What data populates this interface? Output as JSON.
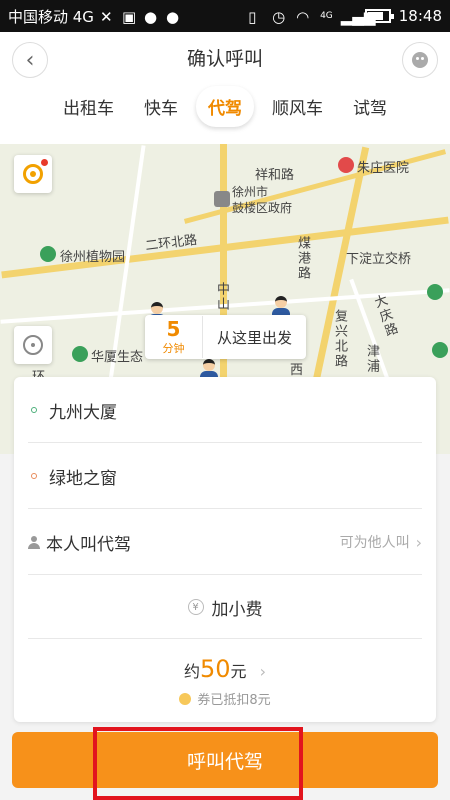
{
  "status_bar": {
    "carrier": "中国移动 4G",
    "network": "4G",
    "time": "18:48"
  },
  "header": {
    "title": "确认呼叫",
    "tabs": [
      {
        "label": "出租车",
        "active": false
      },
      {
        "label": "快车",
        "active": false
      },
      {
        "label": "代驾",
        "active": true
      },
      {
        "label": "顺风车",
        "active": false
      },
      {
        "label": "试驾",
        "active": false
      }
    ]
  },
  "map": {
    "labels": {
      "road_xianghe": "祥和路",
      "hospital": "朱庄医院",
      "gov": "徐州市\n鼓楼区政府",
      "botanical": "徐州植物园",
      "ring_road": "二环北路",
      "meigang": "煤港路",
      "xiadian": "下淀立交桥",
      "zhongshan": "中山",
      "daqing": "大庆路",
      "fuxing": "复兴北路",
      "jinpu": "津浦",
      "huaxia": "华厦生态",
      "xi": "西",
      "wu": "环"
    },
    "eta": {
      "minutes": "5",
      "unit": "分钟",
      "text": "从这里出发"
    }
  },
  "form": {
    "start": "九州大厦",
    "destination": "绿地之窗",
    "caller": "本人叫代驾",
    "for_others": "可为他人叫",
    "tip_label": "加小费",
    "price_prefix": "约",
    "price_value": "50",
    "price_unit": "元",
    "coupon_text": "券已抵扣8元"
  },
  "call_button": {
    "label": "呼叫代驾"
  },
  "colors": {
    "accent": "#f08a00",
    "button": "#f7911a",
    "highlight": "#e2141e"
  }
}
